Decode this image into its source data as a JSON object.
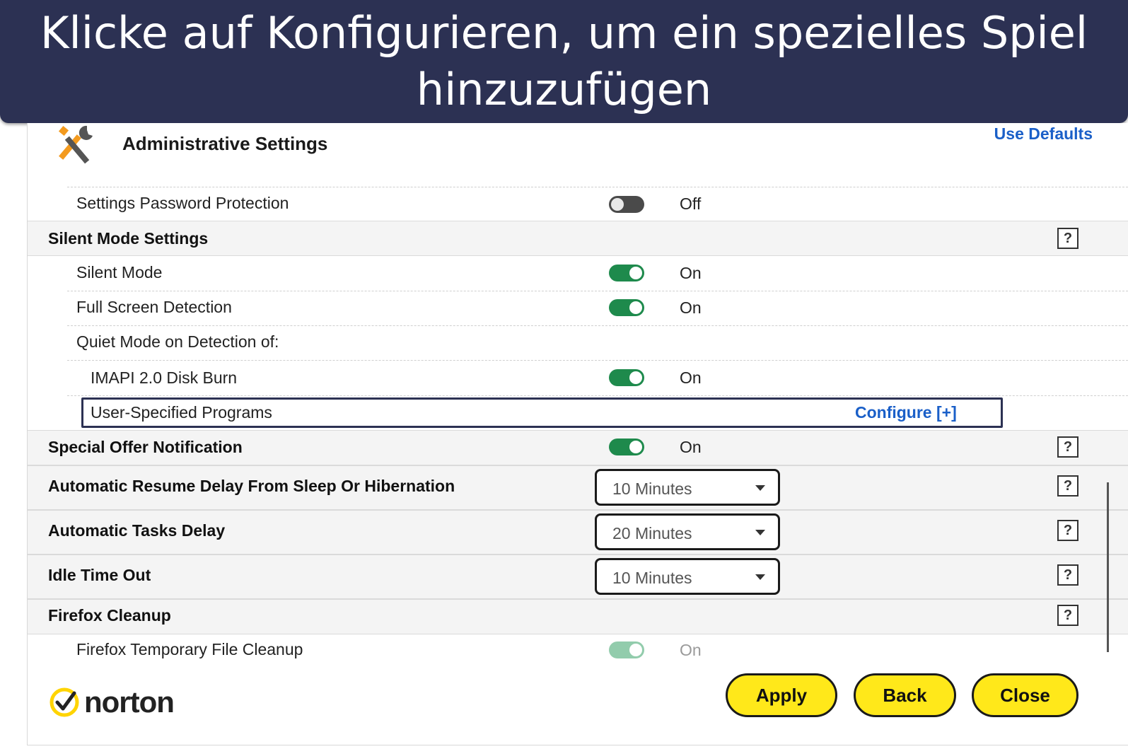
{
  "banner": {
    "text": "Klicke auf Konfigurieren, um ein spezielles Spiel hinzuzufügen"
  },
  "header": {
    "title": "Administrative Settings",
    "use_defaults": "Use Defaults"
  },
  "rows": {
    "settings_password": {
      "label": "Settings Password Protection",
      "state": "Off"
    },
    "silent_mode_section": {
      "label": "Silent Mode Settings",
      "help": "?"
    },
    "silent_mode": {
      "label": "Silent Mode",
      "state": "On"
    },
    "full_screen": {
      "label": "Full Screen Detection",
      "state": "On"
    },
    "quiet_mode": {
      "label": "Quiet Mode on Detection of:"
    },
    "imapi": {
      "label": "IMAPI 2.0 Disk Burn",
      "state": "On"
    },
    "user_programs": {
      "label": "User-Specified Programs",
      "configure": "Configure [+]"
    },
    "special_offer": {
      "label": "Special Offer Notification",
      "state": "On",
      "help": "?"
    },
    "resume_delay": {
      "label": "Automatic Resume Delay From Sleep Or Hibernation",
      "value": "10 Minutes",
      "help": "?"
    },
    "tasks_delay": {
      "label": "Automatic Tasks Delay",
      "value": "20 Minutes",
      "help": "?"
    },
    "idle_timeout": {
      "label": "Idle Time Out",
      "value": "10 Minutes",
      "help": "?"
    },
    "firefox_cleanup": {
      "label": "Firefox Cleanup",
      "help": "?"
    },
    "firefox_temp": {
      "label": "Firefox Temporary File Cleanup",
      "state": "On"
    }
  },
  "buttons": {
    "apply": "Apply",
    "back": "Back",
    "close": "Close"
  },
  "logo": {
    "text": "norton",
    "check_icon": "checkmark-circle-icon"
  },
  "colors": {
    "banner_bg": "#2c3153",
    "toggle_on": "#1e8a4c",
    "link": "#1a5fc8",
    "button_yellow": "#ffe81a"
  }
}
